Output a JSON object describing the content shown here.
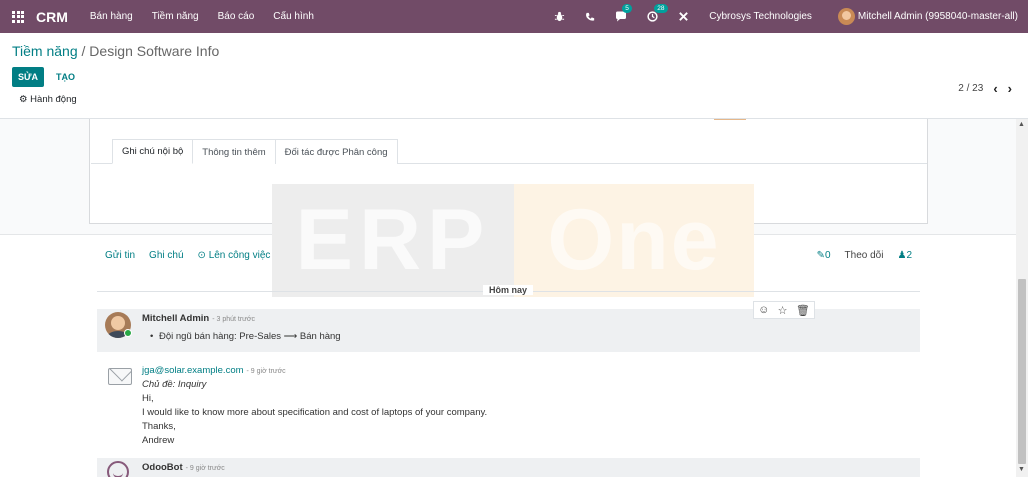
{
  "navbar": {
    "brand": "CRM",
    "menu": [
      "Bán hàng",
      "Tiềm năng",
      "Báo cáo",
      "Cấu hình"
    ],
    "bug_icon": "bug-icon",
    "phone_icon": "phone-icon",
    "messages_badge": "5",
    "activities_badge": "28",
    "company": "Cybrosys Technologies",
    "user": "Mitchell Admin (9958040-master-all)"
  },
  "control": {
    "breadcrumb_parent": "Tiềm năng",
    "breadcrumb_sep": "/",
    "breadcrumb_current": "Design Software Info",
    "edit_label": "SỬA",
    "create_label": "TẠO",
    "action_label": "Hành động",
    "pager_value": "2 / 23"
  },
  "tabs": [
    "Ghi chú nội bộ",
    "Thông tin thêm",
    "Đối tác được Phân công"
  ],
  "watermark": {
    "left": "ERP",
    "right": "One"
  },
  "chatter": {
    "send_message": "Gửi tin",
    "log_note": "Ghi chú",
    "schedule_activity": "Lên công việc",
    "attachments": "0",
    "follow": "Theo dõi",
    "followers": "2",
    "today": "Hôm nay"
  },
  "messages": [
    {
      "author": "Mitchell Admin",
      "time": "- 3 phút trước",
      "tracking": "Đội ngũ bán hàng: Pre-Sales ⟶ Bán hàng"
    },
    {
      "author": "jga@solar.example.com",
      "time": "- 9 giờ trước",
      "subject": "Chủ đề: Inquiry",
      "lines": [
        "Hi,",
        "I would like to know more about specification and cost of laptops of your company.",
        "Thanks,",
        "Andrew"
      ]
    },
    {
      "author": "OdooBot",
      "time": "- 9 giờ trước"
    }
  ],
  "colors": {
    "navbar": "#714b67",
    "primary": "#017e84",
    "online": "#28a745"
  }
}
